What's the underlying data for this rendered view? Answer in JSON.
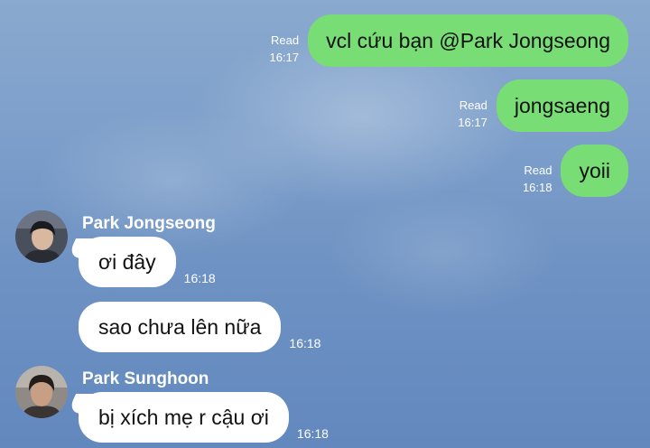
{
  "outgoing": [
    {
      "status": "Read",
      "time": "16:17",
      "text": "vcl cứu bạn @Park Jongseong"
    },
    {
      "status": "Read",
      "time": "16:17",
      "text": "jongsaeng"
    },
    {
      "status": "Read",
      "time": "16:18",
      "text": "yoii"
    }
  ],
  "groups": [
    {
      "sender": "Park Jongseong",
      "avatar_icon": "profile-photo",
      "messages": [
        {
          "text": "ơi đây",
          "time": "16:18"
        },
        {
          "text": "sao chưa lên nữa",
          "time": "16:18"
        }
      ]
    },
    {
      "sender": "Park Sunghoon",
      "avatar_icon": "profile-photo",
      "messages": [
        {
          "text": "bị xích mẹ r cậu ơi",
          "time": "16:18"
        }
      ]
    }
  ],
  "colors": {
    "outgoing_bubble": "#78dd74",
    "incoming_bubble": "#ffffff",
    "background": "#7d9fca"
  }
}
